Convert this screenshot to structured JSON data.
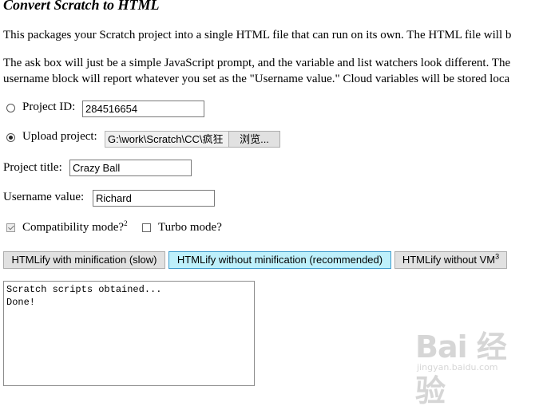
{
  "page": {
    "title": "Convert Scratch to HTML",
    "intro_lines": [
      "This packages your Scratch project into a single HTML file that can run on its own. The HTML file will b",
      "The ask box will just be a simple JavaScript prompt, and the variable and list watchers look different. The",
      "username block will report whatever you set as the \"Username value.\" Cloud variables will be stored loca"
    ]
  },
  "form": {
    "project_id": {
      "label": "Project ID:",
      "value": "284516654",
      "selected": false
    },
    "upload_project": {
      "label": "Upload project:",
      "file_path": "G:\\work\\Scratch\\CC\\疯狂",
      "browse_label": "浏览...",
      "selected": true
    },
    "project_title": {
      "label": "Project title:",
      "value": "Crazy Ball"
    },
    "username": {
      "label": "Username value:",
      "value": "Richard"
    },
    "compatibility_mode": {
      "label": "Compatibility mode?",
      "footnote": "2",
      "checked": true
    },
    "turbo_mode": {
      "label": "Turbo mode?",
      "checked": false
    }
  },
  "actions": {
    "minified": "HTMLify with minification (slow)",
    "unminified": "HTMLify without minification (recommended)",
    "without_vm": "HTMLify without VM",
    "without_vm_footnote": "3"
  },
  "console": {
    "lines": [
      "Scratch scripts obtained...",
      "Done!"
    ]
  },
  "watermark": {
    "logo_text": "Bai 经验",
    "url": "jingyan.baidu.com"
  },
  "colors": {
    "active_button_bg": "#bef0fb",
    "active_button_border": "#3c9bcc",
    "button_bg": "#e1e1e1"
  }
}
